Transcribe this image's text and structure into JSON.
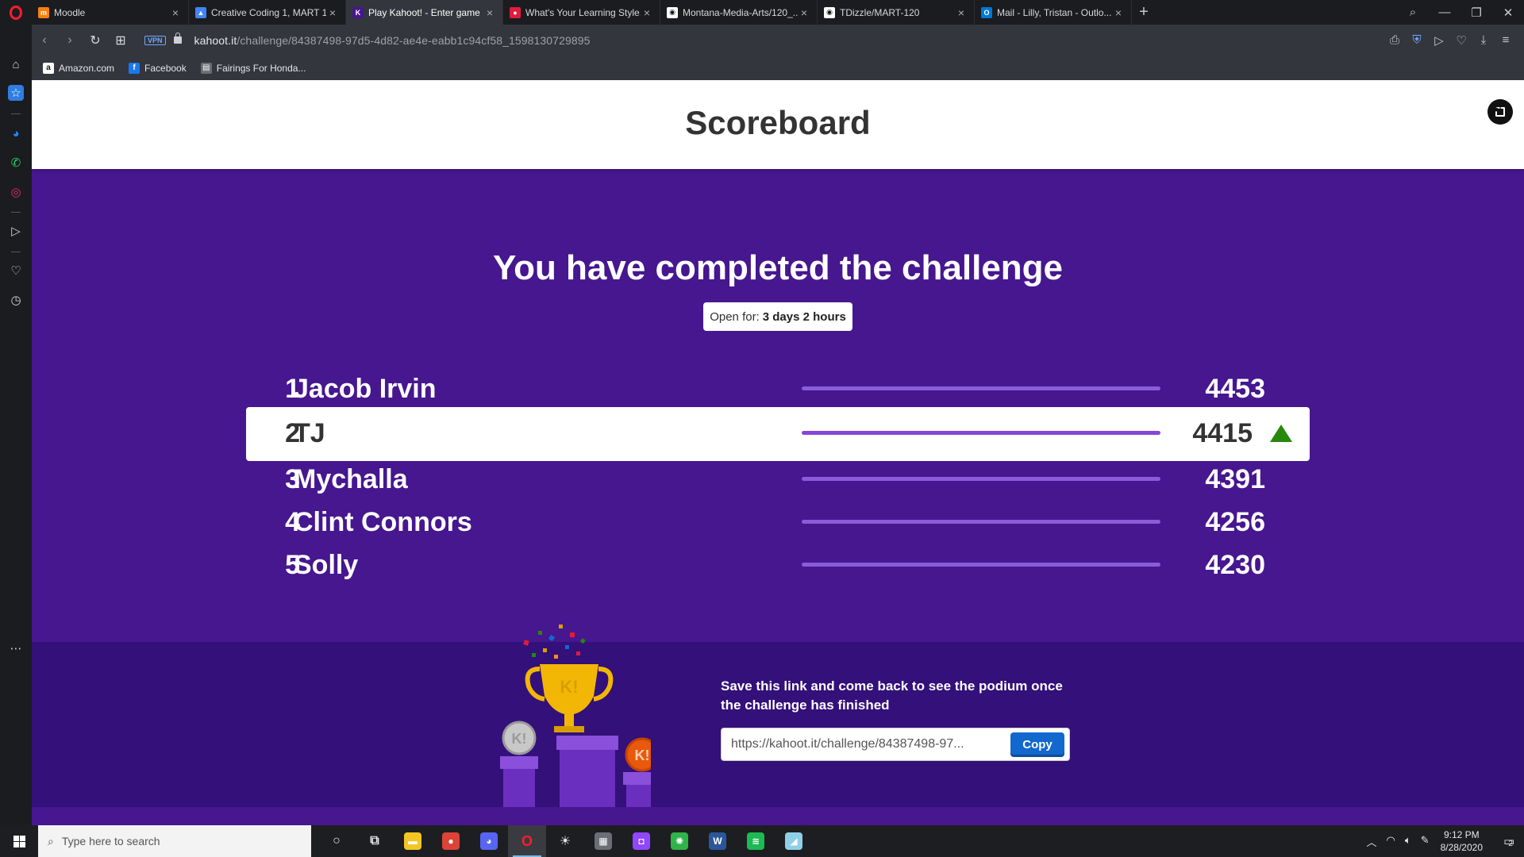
{
  "browser": {
    "tabs": [
      {
        "title": "Moodle",
        "favicon_color": "#f98012",
        "favicon_text": "m",
        "active": false
      },
      {
        "title": "Creative Coding 1, MART 1...",
        "favicon_color": "#4285f4",
        "favicon_text": "▲",
        "active": false
      },
      {
        "title": "Play Kahoot! - Enter game P...",
        "favicon_color": "#46178f",
        "favicon_text": "K",
        "active": true
      },
      {
        "title": "What's Your Learning Style...",
        "favicon_color": "#e21b3c",
        "favicon_text": "●",
        "active": false
      },
      {
        "title": "Montana-Media-Arts/120_...",
        "favicon_color": "#ffffff",
        "favicon_text": "◉",
        "active": false
      },
      {
        "title": "TDizzle/MART-120",
        "favicon_color": "#ffffff",
        "favicon_text": "◉",
        "active": false
      },
      {
        "title": "Mail - Lilly, Tristan - Outlo...",
        "favicon_color": "#0078d4",
        "favicon_text": "O",
        "active": false
      }
    ],
    "close_glyph": "×",
    "new_tab_glyph": "+",
    "url_host": "kahoot.it",
    "url_path": "/challenge/84387498-97d5-4d82-ae4e-eabb1c94cf58_1598130729895",
    "vpn_label": "VPN",
    "bookmarks": [
      {
        "label": "Amazon.com",
        "icon": "a",
        "color": "#ffffff",
        "text_color": "#111111"
      },
      {
        "label": "Facebook",
        "icon": "f",
        "color": "#1877f2",
        "text_color": "#ffffff"
      },
      {
        "label": "Fairings For Honda...",
        "icon": "▤",
        "color": "#6b6d72",
        "text_color": "#ffffff"
      }
    ]
  },
  "page": {
    "header_title": "Scoreboard",
    "completed_title": "You have completed the challenge",
    "open_for_label": "Open for:",
    "open_for_value": "3 days 2 hours",
    "leaderboard": [
      {
        "rank": "1",
        "name": "Jacob Irvin",
        "score": "4453",
        "highlight": false
      },
      {
        "rank": "2",
        "name": "TJ",
        "score": "4415",
        "highlight": true
      },
      {
        "rank": "3",
        "name": "Mychalla",
        "score": "4391",
        "highlight": false
      },
      {
        "rank": "4",
        "name": "Clint Connors",
        "score": "4256",
        "highlight": false
      },
      {
        "rank": "5",
        "name": "Solly",
        "score": "4230",
        "highlight": false
      }
    ],
    "save_text": "Save this link and come back to see the podium once the challenge has finished",
    "share_link": "https://kahoot.it/challenge/84387498-97...",
    "copy_label": "Copy",
    "colors": {
      "kahoot_purple": "#46178f",
      "footer_purple": "#33107a",
      "copy_blue": "#1368ce",
      "up_green": "#26890c"
    }
  },
  "taskbar": {
    "search_placeholder": "Type here to search",
    "time": "9:12 PM",
    "date": "8/28/2020",
    "notification_count": "2",
    "apps": [
      {
        "name": "cortana-icon",
        "glyph": "○",
        "color": "transparent"
      },
      {
        "name": "task-view-icon",
        "glyph": "⧉",
        "color": "transparent"
      },
      {
        "name": "file-explorer-icon",
        "glyph": "▬",
        "color": "#f3c623"
      },
      {
        "name": "chrome-icon",
        "glyph": "●",
        "color": "#db4437"
      },
      {
        "name": "discord-icon",
        "glyph": "◕",
        "color": "#5865f2"
      },
      {
        "name": "opera-icon",
        "glyph": "O",
        "color": "#ff1b2d"
      },
      {
        "name": "brightness-icon",
        "glyph": "☀",
        "color": "transparent"
      },
      {
        "name": "photos-icon",
        "glyph": "▦",
        "color": "#6b6e75"
      },
      {
        "name": "twitch-icon",
        "glyph": "◘",
        "color": "#9146ff"
      },
      {
        "name": "network-app-icon",
        "glyph": "✺",
        "color": "#2fb34a"
      },
      {
        "name": "word-icon",
        "glyph": "W",
        "color": "#2b579a"
      },
      {
        "name": "spotify-icon",
        "glyph": "≋",
        "color": "#1db954"
      },
      {
        "name": "notes-icon",
        "glyph": "◢",
        "color": "#8fd0e8"
      }
    ]
  }
}
